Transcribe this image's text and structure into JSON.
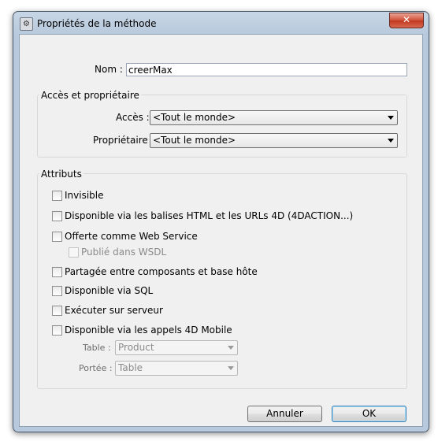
{
  "window": {
    "title": "Propriétés de la méthode",
    "close_glyph": "✕"
  },
  "name_field": {
    "label": "Nom :",
    "value": "creerMax"
  },
  "access_group": {
    "title": "Accès et propriétaire",
    "access_label": "Accès :",
    "access_value": "<Tout le monde>",
    "owner_label": "Propriétaire :",
    "owner_value": "<Tout le monde>"
  },
  "attributes_group": {
    "title": "Attributs",
    "invisible": "Invisible",
    "html_urls": "Disponible via les balises HTML et les URLs 4D (4DACTION...)",
    "web_service": "Offerte comme Web Service",
    "wsdl": "Publié dans WSDL",
    "shared": "Partagée entre composants et base hôte",
    "sql": "Disponible via SQL",
    "server": "Exécuter sur serveur",
    "mobile": "Disponible via les appels 4D Mobile",
    "table_label": "Table :",
    "table_value": "Product",
    "scope_label": "Portée :",
    "scope_value": "Table"
  },
  "buttons": {
    "cancel": "Annuler",
    "ok": "OK"
  }
}
